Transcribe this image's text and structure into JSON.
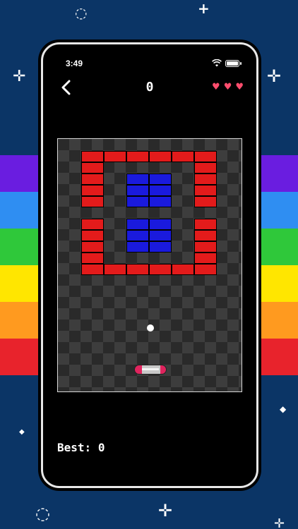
{
  "status_bar": {
    "time": "3:49"
  },
  "header": {
    "score": "0",
    "lives": 3
  },
  "footer": {
    "best_label": "Best:",
    "best_value": "0"
  },
  "colors": {
    "background": "#0b3566",
    "brick_red": "#e31b1b",
    "brick_blue": "#1a1add",
    "rainbow": [
      "#6a1de0",
      "#2f8ef2",
      "#2fc83a",
      "#ffe600",
      "#ff9a1f",
      "#e8232c"
    ]
  },
  "icons": [
    "back-chevron-icon",
    "wifi-icon",
    "battery-icon",
    "heart-icon"
  ]
}
